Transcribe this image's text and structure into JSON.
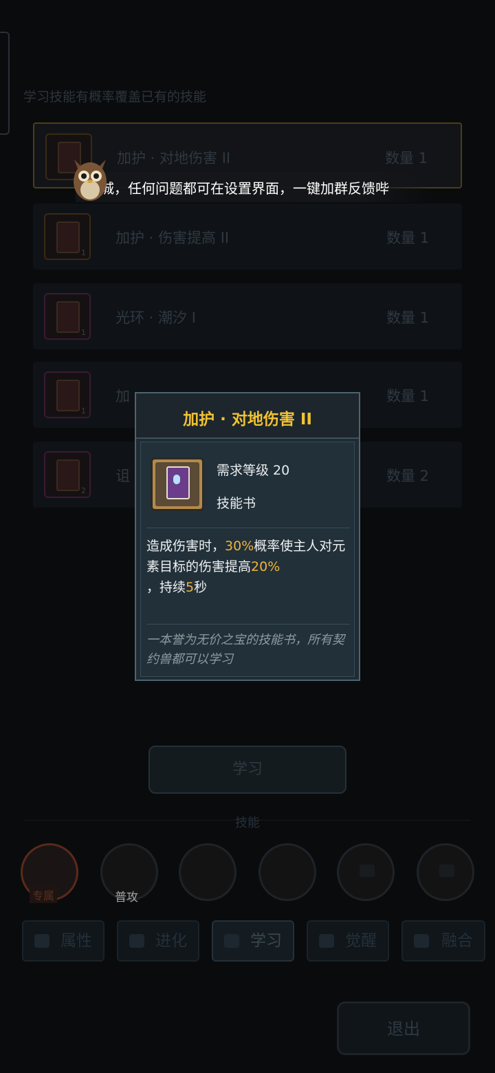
{
  "hint": "学习技能有概率覆盖已有的技能",
  "skill_books": [
    {
      "name": "加护 · 对地伤害 II",
      "qty": "数量 1",
      "count": "",
      "selected": true
    },
    {
      "name": "加护 · 伤害提高 II",
      "qty": "数量 1",
      "count": "1"
    },
    {
      "name": "光环 · 潮汐 I",
      "qty": "数量 1",
      "count": "1"
    },
    {
      "name": "加",
      "qty": "数量 1",
      "count": "1"
    },
    {
      "name": "诅",
      "qty": "数量 2",
      "count": "2"
    }
  ],
  "banner": "城，任何问题都可在设置界面，一键加群反馈哔",
  "popup": {
    "title": "加护 · 对地伤害 II",
    "level_req": "需求等级 20",
    "item_type": "技能书",
    "desc_a": "造成伤害时，",
    "desc_b": "30%",
    "desc_c": "概率使主人对元素目标的伤害提高",
    "desc_d": "20%",
    "desc_e": "，持续",
    "desc_f": "5",
    "desc_g": "秒",
    "flavor": "一本誉为无价之宝的技能书，所有契约兽都可以学习"
  },
  "learn_button": "学习",
  "skills_label": "技能",
  "skills": [
    {
      "tag": "专属",
      "icon": "exclusive-skill-icon"
    },
    {
      "tag": "普攻",
      "icon": "normal-attack-icon"
    },
    {
      "tag": "",
      "icon": "burst-skill-icon"
    },
    {
      "tag": "",
      "icon": "locked-skill-icon"
    },
    {
      "tag": "",
      "icon": "lock-icon"
    },
    {
      "tag": "",
      "icon": "lock-icon"
    }
  ],
  "tabs": [
    "属性",
    "进化",
    "学习",
    "觉醒",
    "融合"
  ],
  "exit_button": "退出",
  "colors": {
    "highlight": "#f2b43a",
    "title": "#f2c232",
    "panel": "#1f2c33"
  }
}
